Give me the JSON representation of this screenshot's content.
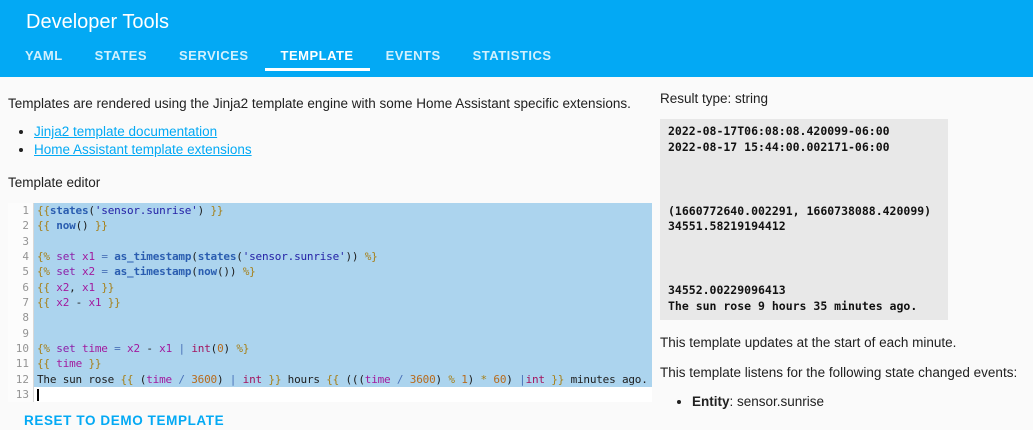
{
  "header": {
    "title": "Developer Tools",
    "tabs": [
      {
        "label": "YAML",
        "active": false
      },
      {
        "label": "STATES",
        "active": false
      },
      {
        "label": "SERVICES",
        "active": false
      },
      {
        "label": "TEMPLATE",
        "active": true
      },
      {
        "label": "EVENTS",
        "active": false
      },
      {
        "label": "STATISTICS",
        "active": false
      }
    ]
  },
  "intro": {
    "description": "Templates are rendered using the Jinja2 template engine with some Home Assistant specific extensions.",
    "links": [
      "Jinja2 template documentation",
      "Home Assistant template extensions"
    ]
  },
  "editor": {
    "label": "Template editor",
    "lines": [
      "{{states('sensor.sunrise') }}",
      "{{ now() }}",
      "",
      "{% set x1 = as_timestamp(states('sensor.sunrise')) %}",
      "{% set x2 = as_timestamp(now()) %}",
      "{{ x2, x1 }}",
      "{{ x2 - x1 }}",
      "",
      "",
      "{% set time = x2 - x1 | int(0) %}",
      "{{ time }}",
      "The sun rose {{ (time / 3600) | int }} hours {{ (((time / 3600) % 1) * 60) |int }} minutes ago.",
      ""
    ],
    "selected_lines": 12
  },
  "result": {
    "type_label": "Result type: string",
    "output_lines": [
      "2022-08-17T06:08:08.420099-06:00",
      "2022-08-17 15:44:00.002171-06:00",
      "",
      "",
      "",
      "(1660772640.002291, 1660738088.420099)",
      "34551.58219194412",
      "",
      "",
      "",
      "34552.00229096413",
      "The sun rose 9 hours 35 minutes ago."
    ]
  },
  "info": {
    "updates": "This template updates at the start of each minute.",
    "listens": "This template listens for the following state changed events:",
    "entity_label": "Entity",
    "entity_rest": ": sensor.sunrise"
  },
  "actions": {
    "reset_label": "RESET TO DEMO TEMPLATE"
  },
  "colors": {
    "primary": "#03a9f4",
    "selection": "#acd4ee",
    "result-bg": "#e8e8e8"
  }
}
